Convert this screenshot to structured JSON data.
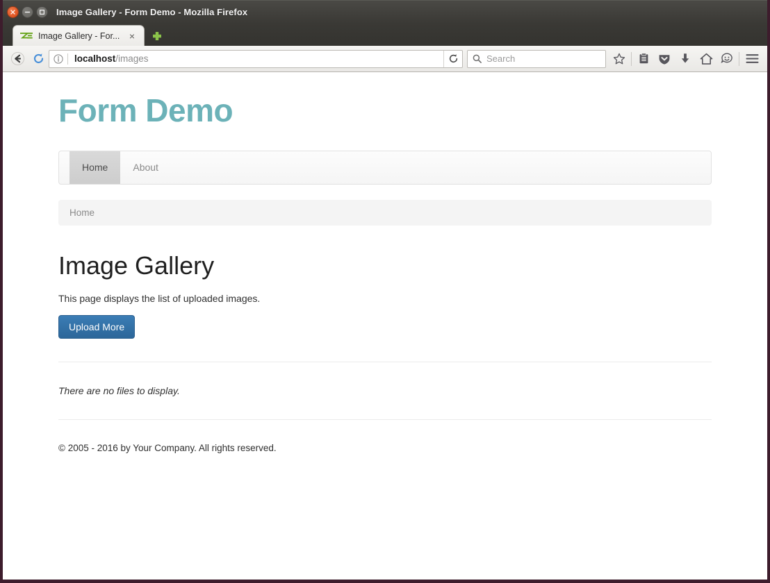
{
  "window": {
    "title": "Image Gallery - Form Demo - Mozilla Firefox",
    "close_glyph": "×",
    "minimize_glyph": "−",
    "maximize_glyph": "□"
  },
  "tabbar": {
    "tabs": [
      {
        "title": "Image Gallery - For...",
        "favicon": "zf-logo-icon",
        "close_glyph": "×"
      }
    ],
    "new_tab_glyph": "+"
  },
  "toolbar": {
    "back_icon": "back-arrow-icon",
    "forward_icon": "forward-arrow-icon",
    "reload_icon": "reload-icon",
    "identity_icon": "info-icon",
    "url_host": "localhost",
    "url_path": "/images",
    "search": {
      "placeholder": "Search",
      "icon": "search-icon",
      "value": ""
    },
    "buttons": [
      {
        "name": "bookmark-star-button",
        "icon": "star-icon"
      },
      {
        "name": "library-button",
        "icon": "library-icon"
      },
      {
        "name": "pocket-button",
        "icon": "pocket-shield-icon"
      },
      {
        "name": "downloads-button",
        "icon": "download-arrow-icon"
      },
      {
        "name": "home-button",
        "icon": "home-icon"
      },
      {
        "name": "hello-button",
        "icon": "smiley-icon"
      },
      {
        "name": "menu-button",
        "icon": "hamburger-menu-icon"
      }
    ]
  },
  "page": {
    "brand": "Form Demo",
    "nav": [
      {
        "label": "Home",
        "active": true
      },
      {
        "label": "About",
        "active": false
      }
    ],
    "breadcrumb": "Home",
    "title": "Image Gallery",
    "description": "This page displays the list of uploaded images.",
    "upload_button": "Upload More",
    "empty_message": "There are no files to display.",
    "footer": "© 2005 - 2016 by Your Company. All rights reserved."
  },
  "colors": {
    "brand_teal": "#6cb2b8",
    "primary_blue": "#2c6699",
    "window_border": "#3d1c2c",
    "titlebar": "#3a3935"
  }
}
